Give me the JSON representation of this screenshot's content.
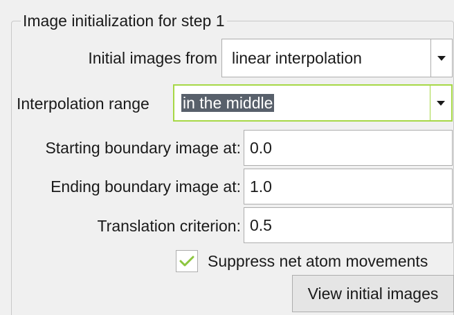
{
  "group": {
    "title": "Image initialization for step 1"
  },
  "initial_images": {
    "label": "Initial images from",
    "value": "linear interpolation"
  },
  "interpolation_range": {
    "label": "Interpolation range",
    "value": "in the middle"
  },
  "starting_boundary": {
    "label": "Starting boundary image at:",
    "value": "0.0"
  },
  "ending_boundary": {
    "label": "Ending boundary image at:",
    "value": "1.0"
  },
  "translation": {
    "label": "Translation criterion:",
    "value": "0.5"
  },
  "suppress": {
    "label": "Suppress net atom movements",
    "checked": true
  },
  "view_button": {
    "label": "View initial images"
  },
  "colors": {
    "check": "#8dc63f",
    "focus_border": "#a6d845",
    "selection_bg": "#58606b"
  }
}
